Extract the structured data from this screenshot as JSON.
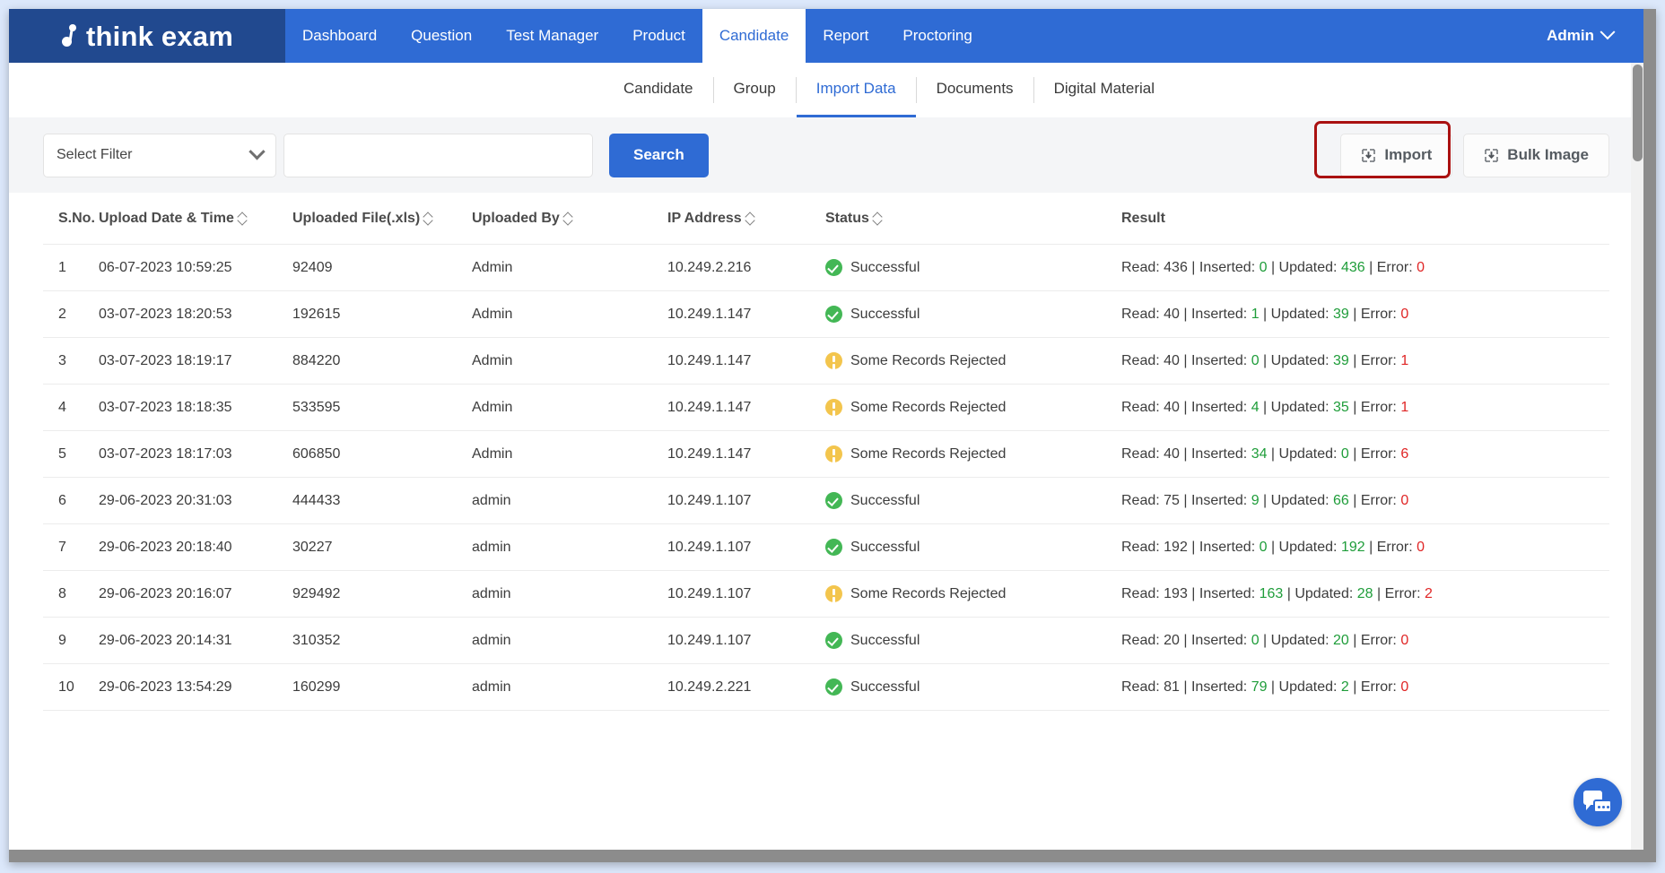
{
  "brand": {
    "name": "think exam",
    "logo_icon": "music-note-icon"
  },
  "topnav": {
    "items": [
      {
        "label": "Dashboard",
        "active": false
      },
      {
        "label": "Question",
        "active": false
      },
      {
        "label": "Test Manager",
        "active": false
      },
      {
        "label": "Product",
        "active": false
      },
      {
        "label": "Candidate",
        "active": true
      },
      {
        "label": "Report",
        "active": false
      },
      {
        "label": "Proctoring",
        "active": false
      }
    ],
    "user": {
      "label": "Admin",
      "chevron_icon": "chevron-down-icon"
    }
  },
  "subnav": {
    "items": [
      {
        "label": "Candidate",
        "active": false
      },
      {
        "label": "Group",
        "active": false
      },
      {
        "label": "Import Data",
        "active": true
      },
      {
        "label": "Documents",
        "active": false
      },
      {
        "label": "Digital Material",
        "active": false
      }
    ]
  },
  "filterbar": {
    "select_filter_label": "Select Filter",
    "select_chevron_icon": "chevron-down-icon",
    "search_value": "",
    "search_placeholder": "",
    "search_button_label": "Search",
    "import_button_label": "Import",
    "import_icon": "import-download-icon",
    "bulk_image_button_label": "Bulk Image",
    "bulk_image_icon": "import-download-icon",
    "highlight_color": "#aa1111"
  },
  "table": {
    "columns": [
      {
        "label": "S.No.",
        "sortable": false
      },
      {
        "label": "Upload Date & Time",
        "sortable": true
      },
      {
        "label": "Uploaded File(.xls)",
        "sortable": true
      },
      {
        "label": "Uploaded By",
        "sortable": true
      },
      {
        "label": "IP Address",
        "sortable": true
      },
      {
        "label": "Status",
        "sortable": true
      },
      {
        "label": "Result",
        "sortable": false
      }
    ],
    "rows": [
      {
        "sno": "1",
        "date": "06-07-2023 10:59:25",
        "file": "92409",
        "by": "Admin",
        "ip": "10.249.2.216",
        "status": "Successful",
        "status_type": "success",
        "read_label": "Read:",
        "read": "436",
        "inserted_label": "Inserted:",
        "inserted": "0",
        "updated_label": "Updated:",
        "updated": "436",
        "error_label": "Error:",
        "error": "0"
      },
      {
        "sno": "2",
        "date": "03-07-2023 18:20:53",
        "file": "192615",
        "by": "Admin",
        "ip": "10.249.1.147",
        "status": "Successful",
        "status_type": "success",
        "read_label": "Read:",
        "read": "40",
        "inserted_label": "Inserted:",
        "inserted": "1",
        "updated_label": "Updated:",
        "updated": "39",
        "error_label": "Error:",
        "error": "0"
      },
      {
        "sno": "3",
        "date": "03-07-2023 18:19:17",
        "file": "884220",
        "by": "Admin",
        "ip": "10.249.1.147",
        "status": "Some Records Rejected",
        "status_type": "warning",
        "read_label": "Read:",
        "read": "40",
        "inserted_label": "Inserted:",
        "inserted": "0",
        "updated_label": "Updated:",
        "updated": "39",
        "error_label": "Error:",
        "error": "1"
      },
      {
        "sno": "4",
        "date": "03-07-2023 18:18:35",
        "file": "533595",
        "by": "Admin",
        "ip": "10.249.1.147",
        "status": "Some Records Rejected",
        "status_type": "warning",
        "read_label": "Read:",
        "read": "40",
        "inserted_label": "Inserted:",
        "inserted": "4",
        "updated_label": "Updated:",
        "updated": "35",
        "error_label": "Error:",
        "error": "1"
      },
      {
        "sno": "5",
        "date": "03-07-2023 18:17:03",
        "file": "606850",
        "by": "Admin",
        "ip": "10.249.1.147",
        "status": "Some Records Rejected",
        "status_type": "warning",
        "read_label": "Read:",
        "read": "40",
        "inserted_label": "Inserted:",
        "inserted": "34",
        "updated_label": "Updated:",
        "updated": "0",
        "error_label": "Error:",
        "error": "6"
      },
      {
        "sno": "6",
        "date": "29-06-2023 20:31:03",
        "file": "444433",
        "by": "admin",
        "ip": "10.249.1.107",
        "status": "Successful",
        "status_type": "success",
        "read_label": "Read:",
        "read": "75",
        "inserted_label": "Inserted:",
        "inserted": "9",
        "updated_label": "Updated:",
        "updated": "66",
        "error_label": "Error:",
        "error": "0"
      },
      {
        "sno": "7",
        "date": "29-06-2023 20:18:40",
        "file": "30227",
        "by": "admin",
        "ip": "10.249.1.107",
        "status": "Successful",
        "status_type": "success",
        "read_label": "Read:",
        "read": "192",
        "inserted_label": "Inserted:",
        "inserted": "0",
        "updated_label": "Updated:",
        "updated": "192",
        "error_label": "Error:",
        "error": "0"
      },
      {
        "sno": "8",
        "date": "29-06-2023 20:16:07",
        "file": "929492",
        "by": "admin",
        "ip": "10.249.1.107",
        "status": "Some Records Rejected",
        "status_type": "warning",
        "read_label": "Read:",
        "read": "193",
        "inserted_label": "Inserted:",
        "inserted": "163",
        "updated_label": "Updated:",
        "updated": "28",
        "error_label": "Error:",
        "error": "2"
      },
      {
        "sno": "9",
        "date": "29-06-2023 20:14:31",
        "file": "310352",
        "by": "admin",
        "ip": "10.249.1.107",
        "status": "Successful",
        "status_type": "success",
        "read_label": "Read:",
        "read": "20",
        "inserted_label": "Inserted:",
        "inserted": "0",
        "updated_label": "Updated:",
        "updated": "20",
        "error_label": "Error:",
        "error": "0"
      },
      {
        "sno": "10",
        "date": "29-06-2023 13:54:29",
        "file": "160299",
        "by": "admin",
        "ip": "10.249.2.221",
        "status": "Successful",
        "status_type": "success",
        "read_label": "Read:",
        "read": "81",
        "inserted_label": "Inserted:",
        "inserted": "79",
        "updated_label": "Updated:",
        "updated": "2",
        "error_label": "Error:",
        "error": "0"
      }
    ]
  },
  "chat_widget": {
    "icon": "chat-bubbles-icon"
  },
  "colors": {
    "brand_dark": "#21498f",
    "brand_blue": "#2f6bd4",
    "success_green": "#43b755",
    "warning_yellow": "#f3c54d",
    "error_red": "#e02626",
    "value_green": "#1f9d3a"
  }
}
